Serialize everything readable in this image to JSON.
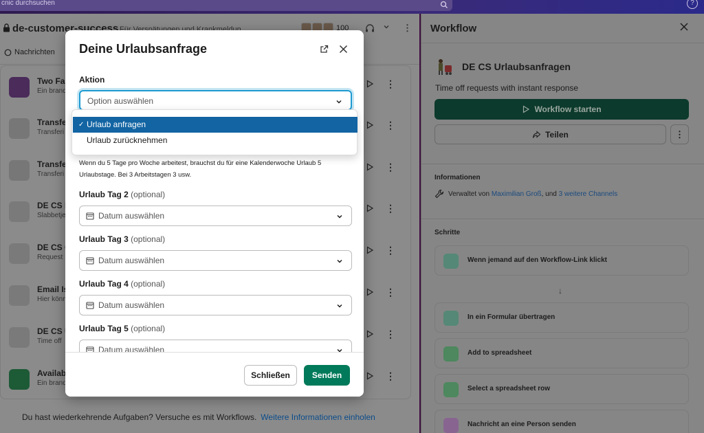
{
  "search": {
    "placeholder_visible": "cnic durchsuchen"
  },
  "channel": {
    "name": "de-customer-success",
    "topic": "Für Verspätungen und Krankmeldun",
    "member_count": "100",
    "tab_label": "Nachrichten"
  },
  "workflow_rows": [
    {
      "title": "Two Fa",
      "sub": "Ein brand",
      "icon": "purple-app-icon",
      "color": "#4a2b5a"
    },
    {
      "title": "Transfe",
      "sub": "Transferi",
      "icon": "person-icon",
      "color": "#777"
    },
    {
      "title": "Transfe",
      "sub": "Transferi",
      "icon": "warning-phone-icon",
      "color": "#777"
    },
    {
      "title": "DE CS E",
      "sub": "Slabbetje",
      "icon": "figure-icon",
      "color": "#7a7a7a"
    },
    {
      "title": "DE CS C",
      "sub": "Request",
      "icon": "bulb-icon",
      "color": "#7a7a7a"
    },
    {
      "title": "Email Is",
      "sub": "Hier könn",
      "icon": "envelope-icon",
      "color": "#7a7a7a"
    },
    {
      "title": "DE CS U",
      "sub": "Time off",
      "icon": "figure-icon",
      "color": "#7a7a7a"
    },
    {
      "title": "Availabi",
      "sub": "Ein brand",
      "icon": "green-app-icon",
      "color": "#1d5a36"
    }
  ],
  "footer": {
    "text": "Du hast wiederkehrende Aufgaben? Versuche es mit Workflows.",
    "link": "Weitere Informationen einholen"
  },
  "panel": {
    "title": "Workflow",
    "workflow_name": "DE CS Urlaubsanfragen",
    "workflow_desc": "Time off requests with instant response",
    "start_label": "Workflow starten",
    "share_label": "Teilen",
    "info_heading": "Informationen",
    "info_prefix": "Verwaltet von",
    "info_person": "Maximilian Groß",
    "info_mid": ", und",
    "info_channels": "3 weitere Channels",
    "steps_heading": "Schritte",
    "steps": [
      {
        "label": "Wenn jemand auf den Workflow-Link klickt",
        "icon": "cursor-click-icon",
        "color": "#2e8a6a"
      },
      {
        "label": "In ein Formular übertragen",
        "icon": "form-edit-icon",
        "color": "#2e8a6a"
      },
      {
        "label": "Add to spreadsheet",
        "icon": "spreadsheet-icon",
        "color": "#1f8a3e"
      },
      {
        "label": "Select a spreadsheet row",
        "icon": "spreadsheet-icon",
        "color": "#1f8a3e"
      },
      {
        "label": "Nachricht an eine Person senden",
        "icon": "message-icon",
        "color": "#8a4a9a"
      }
    ]
  },
  "modal": {
    "title": "Deine Urlaubsanfrage",
    "action_label": "Aktion",
    "action_placeholder": "Option auswählen",
    "options": [
      "Urlaub anfragen",
      "Urlaub zurücknehmen"
    ],
    "selected_option": "Urlaub anfragen",
    "help_text": "Wenn du 5 Tage pro Woche arbeitest, brauchst du für eine Kalenderwoche Urlaub 5 Urlaubstage. Bei 3 Arbeitstagen 3 usw.",
    "date_fields": [
      {
        "label": "Urlaub Tag 2",
        "optional": "(optional)",
        "placeholder": "Datum auswählen"
      },
      {
        "label": "Urlaub Tag 3",
        "optional": "(optional)",
        "placeholder": "Datum auswählen"
      },
      {
        "label": "Urlaub Tag 4",
        "optional": "(optional)",
        "placeholder": "Datum auswählen"
      },
      {
        "label": "Urlaub Tag 5",
        "optional": "(optional)",
        "placeholder": "Datum auswählen"
      }
    ],
    "close_label": "Schließen",
    "send_label": "Senden"
  }
}
